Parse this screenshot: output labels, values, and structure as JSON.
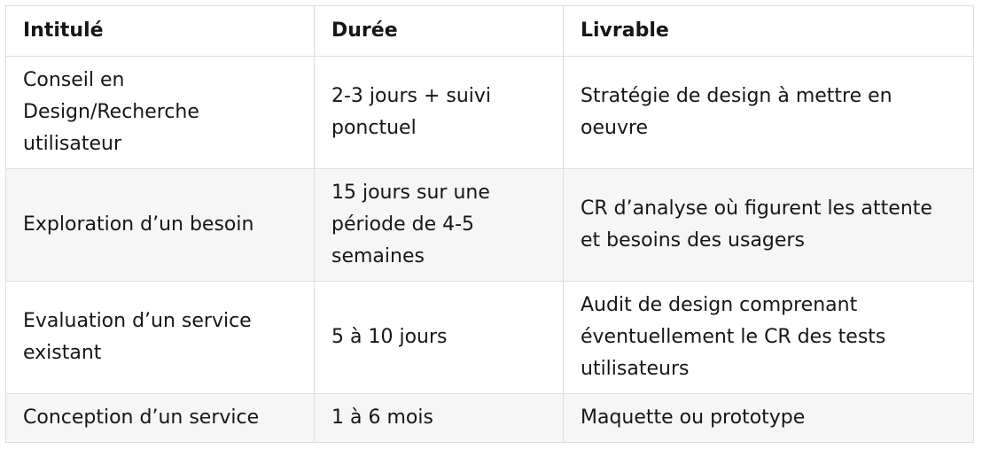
{
  "table": {
    "headers": [
      "Intitulé",
      "Durée",
      "Livrable"
    ],
    "rows": [
      [
        "Conseil en Design/Recherche utilisateur",
        "2-3 jours + suivi ponctuel",
        "Stratégie de design à mettre en oeuvre"
      ],
      [
        "Exploration d’un besoin",
        "15 jours sur une période de 4-5 semaines",
        "CR d’analyse où figurent les attente et besoins des usagers"
      ],
      [
        "Evaluation d’un service existant",
        "5 à 10 jours",
        "Audit de design comprenant éventuellement le CR des tests utilisateurs"
      ],
      [
        "Conception d’un service",
        "1 à 6 mois",
        "Maquette ou prototype"
      ]
    ]
  },
  "colors": {
    "text": "#161616",
    "border": "#dddddd",
    "stripe": "#f6f6f6"
  }
}
